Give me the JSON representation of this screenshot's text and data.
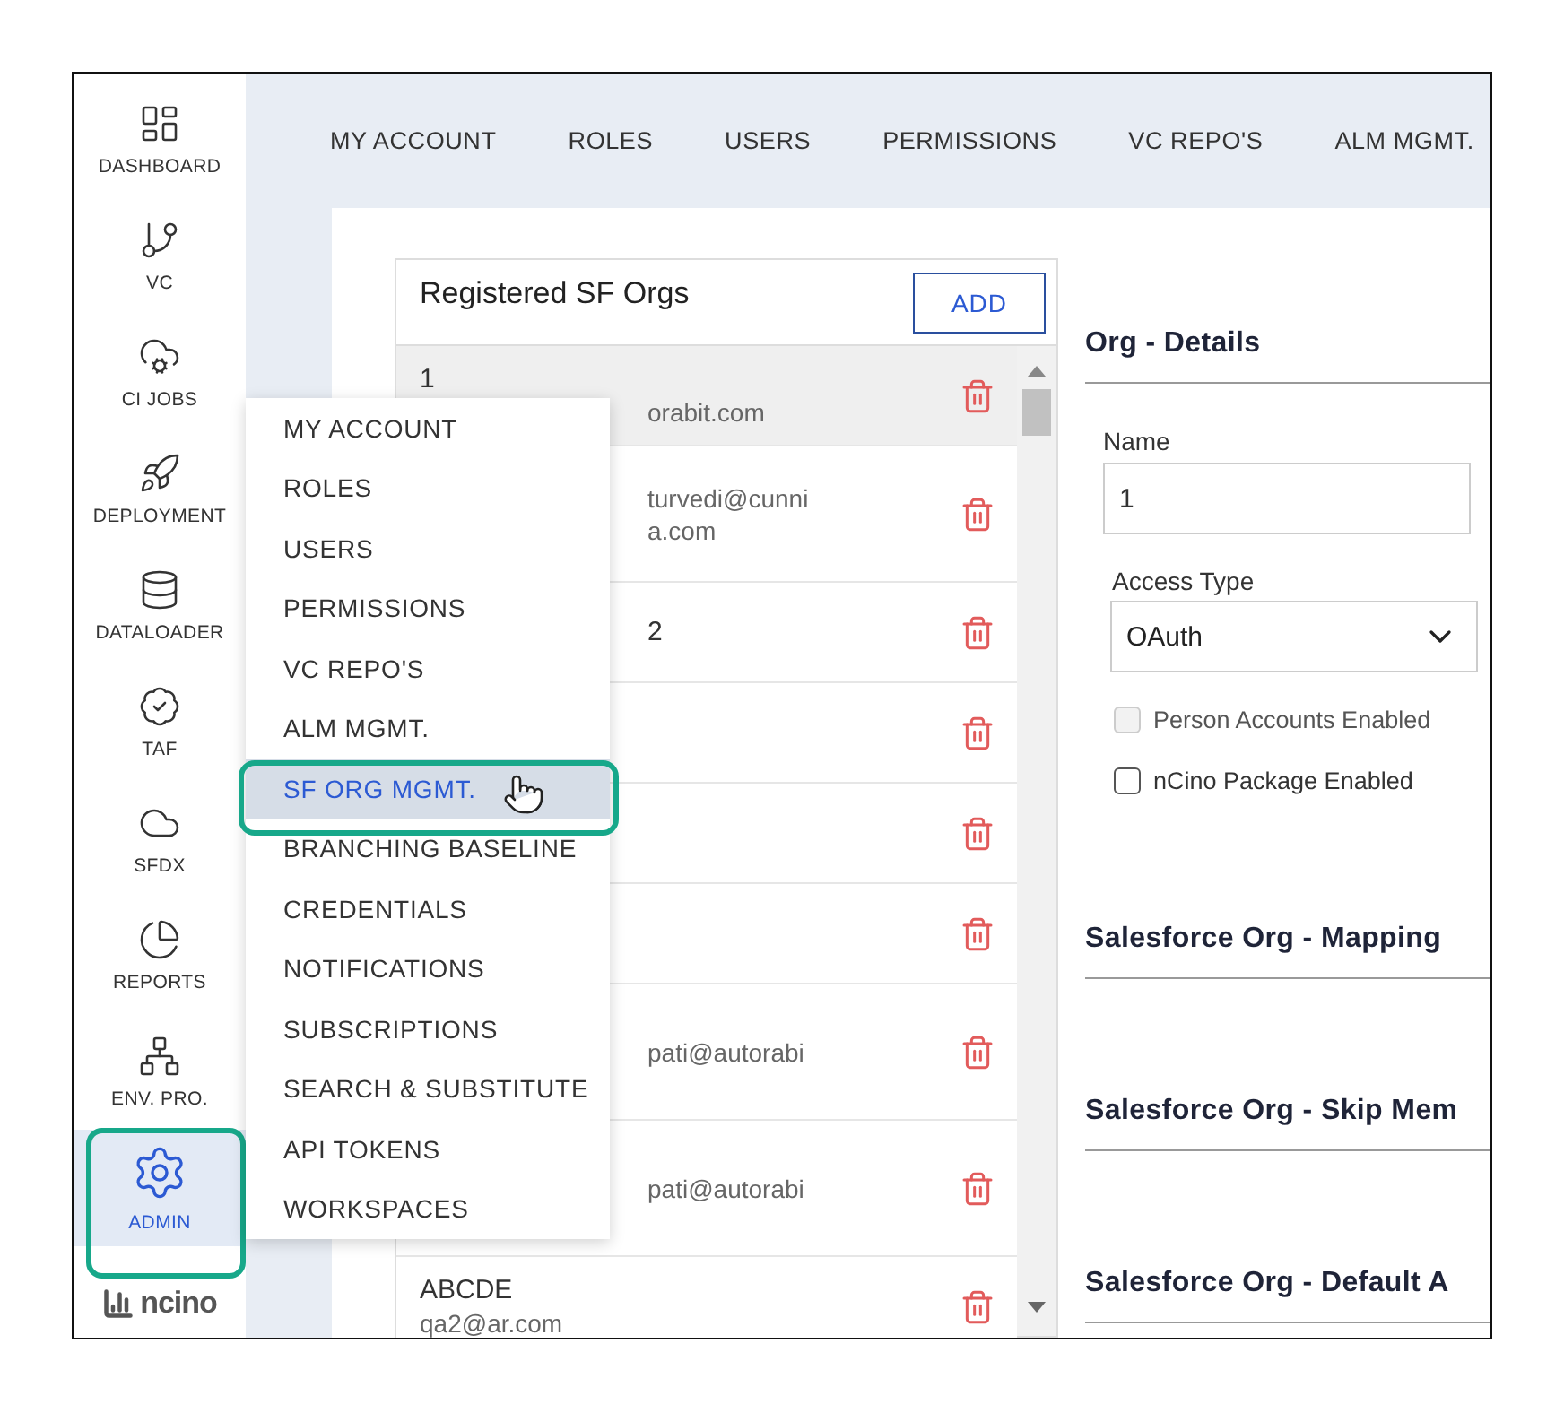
{
  "sidebar": {
    "items": [
      {
        "label": "DASHBOARD",
        "selected": false,
        "highlighted": false
      },
      {
        "label": "VC",
        "selected": false,
        "highlighted": false
      },
      {
        "label": "CI JOBS",
        "selected": false,
        "highlighted": false
      },
      {
        "label": "DEPLOYMENT",
        "selected": false,
        "highlighted": false
      },
      {
        "label": "DATALOADER",
        "selected": false,
        "highlighted": false
      },
      {
        "label": "TAF",
        "selected": false,
        "highlighted": false
      },
      {
        "label": "SFDX",
        "selected": false,
        "highlighted": false
      },
      {
        "label": "REPORTS",
        "selected": false,
        "highlighted": false
      },
      {
        "label": "ENV. PRO.",
        "selected": false,
        "highlighted": false
      },
      {
        "label": "ADMIN",
        "selected": true,
        "highlighted": true
      }
    ],
    "logo": "ncino"
  },
  "top_nav": {
    "tabs": [
      "MY ACCOUNT",
      "ROLES",
      "USERS",
      "PERMISSIONS",
      "VC REPO'S",
      "ALM MGMT."
    ]
  },
  "orgs_panel": {
    "title": "Registered SF Orgs",
    "add_button": "ADD",
    "rows": [
      {
        "selected": true,
        "kind": "short",
        "texts": [
          {
            "kind": "title",
            "text": "1",
            "covered": false
          },
          {
            "kind": "email",
            "text": "orabit.com",
            "covered": true
          }
        ]
      },
      {
        "selected": false,
        "kind": "tall",
        "texts": [
          {
            "kind": "email",
            "text": "turvedi@cunni",
            "covered": true
          },
          {
            "kind": "email",
            "text": "a.com",
            "covered": true
          }
        ]
      },
      {
        "selected": false,
        "kind": "short",
        "texts": [
          {
            "kind": "title",
            "text": "2",
            "covered": true
          }
        ]
      },
      {
        "selected": false,
        "kind": "short",
        "texts": []
      },
      {
        "selected": false,
        "kind": "short",
        "texts": []
      },
      {
        "selected": false,
        "kind": "short",
        "texts": []
      },
      {
        "selected": false,
        "kind": "tall",
        "texts": [
          {
            "kind": "email",
            "text": "pati@autorabi",
            "covered": true
          }
        ]
      },
      {
        "selected": false,
        "kind": "tall",
        "texts": [
          {
            "kind": "email",
            "text": "pati@autorabi",
            "covered": true
          }
        ]
      },
      {
        "selected": false,
        "kind": "short",
        "texts": [
          {
            "kind": "title",
            "text": "ABCDE",
            "covered": false
          },
          {
            "kind": "email",
            "text": "qa2@ar.com",
            "covered": false
          }
        ]
      }
    ]
  },
  "details": {
    "heading": "Org - Details",
    "name_label": "Name",
    "name_value": "1",
    "access_type_label": "Access Type",
    "access_type_value": "OAuth",
    "checkboxes": [
      {
        "label": "Person Accounts Enabled",
        "checked": false,
        "disabled": true
      },
      {
        "label": "nCino Package Enabled",
        "checked": false,
        "disabled": false
      }
    ],
    "sections": [
      "Salesforce Org - Mapping",
      "Salesforce Org - Skip Mem",
      "Salesforce Org - Default A"
    ]
  },
  "admin_menu": {
    "items": [
      {
        "label": "MY ACCOUNT",
        "selected": false,
        "highlighted": false,
        "hovered": false
      },
      {
        "label": "ROLES",
        "selected": false,
        "highlighted": false,
        "hovered": false
      },
      {
        "label": "USERS",
        "selected": false,
        "highlighted": false,
        "hovered": false
      },
      {
        "label": "PERMISSIONS",
        "selected": false,
        "highlighted": false,
        "hovered": false
      },
      {
        "label": "VC REPO'S",
        "selected": false,
        "highlighted": false,
        "hovered": false
      },
      {
        "label": "ALM MGMT.",
        "selected": false,
        "highlighted": false,
        "hovered": false
      },
      {
        "label": "SF ORG MGMT.",
        "selected": true,
        "highlighted": true,
        "hovered": true
      },
      {
        "label": "BRANCHING BASELINE",
        "selected": false,
        "highlighted": false,
        "hovered": false
      },
      {
        "label": "CREDENTIALS",
        "selected": false,
        "highlighted": false,
        "hovered": false
      },
      {
        "label": "NOTIFICATIONS",
        "selected": false,
        "highlighted": false,
        "hovered": false
      },
      {
        "label": "SUBSCRIPTIONS",
        "selected": false,
        "highlighted": false,
        "hovered": false
      },
      {
        "label": "SEARCH & SUBSTITUTE",
        "selected": false,
        "highlighted": false,
        "hovered": false
      },
      {
        "label": "API TOKENS",
        "selected": false,
        "highlighted": false,
        "hovered": false
      },
      {
        "label": "WORKSPACES",
        "selected": false,
        "highlighted": false,
        "hovered": false
      }
    ]
  }
}
